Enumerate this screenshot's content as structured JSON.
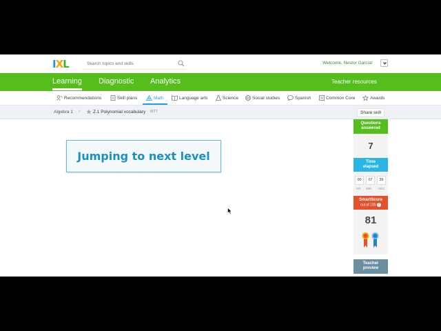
{
  "header": {
    "logo": {
      "part1": "I",
      "part2": "X",
      "part3": "L"
    },
    "search_placeholder": "Search topics and skills",
    "welcome": "Welcome, Nestor García!"
  },
  "main_nav": {
    "tabs": [
      "Learning",
      "Diagnostic",
      "Analytics"
    ],
    "active_tab": "Learning",
    "teacher_resources": "Teacher resources"
  },
  "subject_nav": {
    "items": [
      "Recommendations",
      "Skill plans",
      "Math",
      "Language arts",
      "Science",
      "Social studies",
      "Spanish",
      "Common Core",
      "Awards"
    ],
    "active": "Math"
  },
  "breadcrumb": {
    "course": "Algebra 1",
    "separator": "›",
    "skill": "Z.1 Polynomial vocabulary",
    "code": "MT7",
    "share_label": "Share skill"
  },
  "message": "Jumping to next level",
  "sidebar": {
    "questions_label_1": "Questions",
    "questions_label_2": "answered",
    "questions_value": "7",
    "time_label_1": "Time",
    "time_label_2": "elapsed",
    "time": {
      "hr": "00",
      "min": "07",
      "sec": "39"
    },
    "time_units": {
      "hr": "HR",
      "min": "MIN",
      "sec": "SEC"
    },
    "smartscore_label": "SmartScore",
    "smartscore_sub": "out of 100",
    "smartscore_help": "?",
    "smartscore_value": "81",
    "teacher_preview_1": "Teacher",
    "teacher_preview_2": "preview"
  },
  "colors": {
    "green": "#56be1c",
    "blue": "#2ab5e4",
    "orange": "#e4522d",
    "slate": "#6b8ea0",
    "message_blue": "#1c8fc4"
  }
}
